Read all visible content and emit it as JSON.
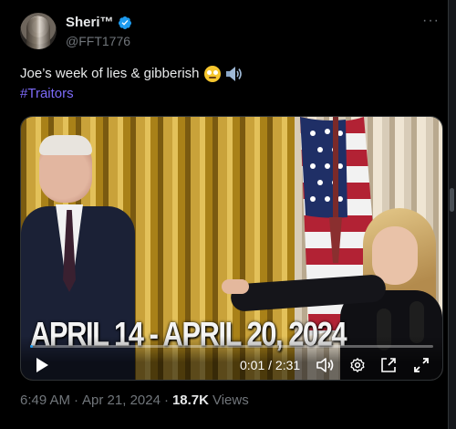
{
  "author": {
    "display_name": "Sheri™",
    "handle": "@FFT1776"
  },
  "tweet": {
    "text": "Joe’s week of lies & gibberish",
    "hashtag": "#Traitors"
  },
  "video": {
    "overlay_text": "APRIL 14 - APRIL 20, 2024",
    "time_display": "0:01 / 2:31",
    "progress": 0.007
  },
  "meta": {
    "time": "6:49 AM",
    "separator": "·",
    "date": "Apr 21, 2024",
    "views_count": "18.7K",
    "views_label": "Views"
  },
  "colors": {
    "background": "#000000",
    "text": "#e7e9ea",
    "muted": "#71767b",
    "accent": "#1d9bf0",
    "hashtag": "#7c6af7"
  },
  "icons": {
    "verified": "verified-badge-icon",
    "more": "more-icon",
    "emoji": "face-with-rolling-eyes-icon",
    "sound": "speaker-icon",
    "play": "play-icon",
    "volume": "volume-icon",
    "settings": "gear-icon",
    "popout": "popout-icon",
    "fullscreen": "fullscreen-icon"
  }
}
